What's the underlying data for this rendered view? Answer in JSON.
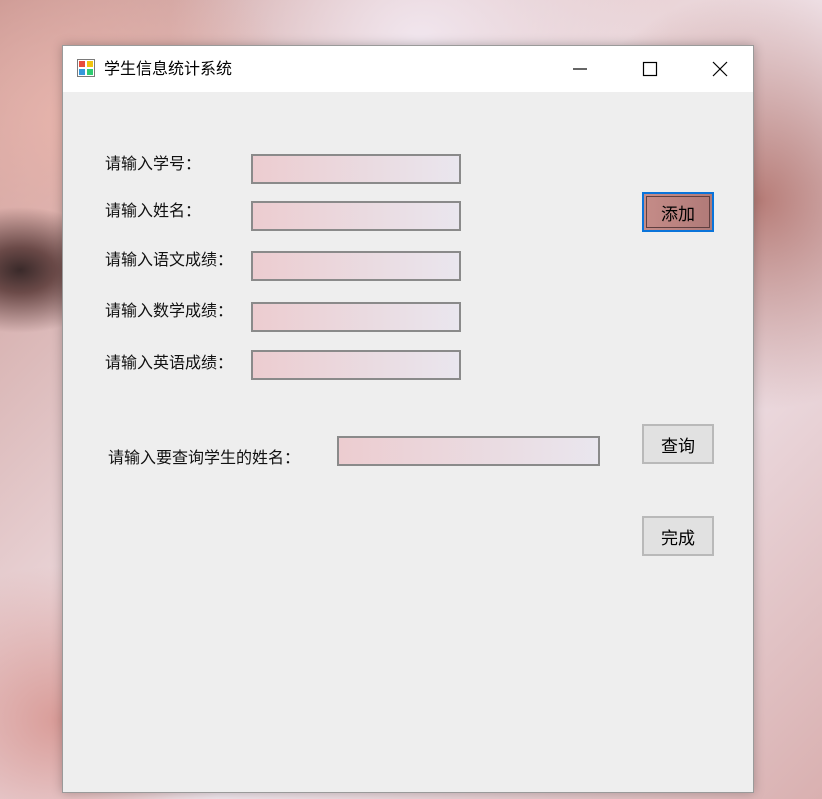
{
  "window": {
    "title": "学生信息统计系统",
    "icon": "windows-forms-app-icon",
    "controls": [
      "minimize-icon",
      "maximize-icon",
      "close-icon"
    ]
  },
  "form": {
    "student_id_label": "请输入学号：",
    "name_label": "请输入姓名：",
    "chinese_label": "请输入语文成绩：",
    "math_label": "请输入数学成绩：",
    "english_label": "请输入英语成绩：",
    "student_id_value": "",
    "name_value": "",
    "chinese_value": "",
    "math_value": "",
    "english_value": "",
    "add_button": "添加"
  },
  "query": {
    "label": "请输入要查询学生的姓名：",
    "value": "",
    "button": "查询"
  },
  "done_button": "完成",
  "colors": {
    "focus_border": "#0a74da",
    "window_bg": "#eeeeee",
    "button_bg": "#e1e1e1"
  }
}
